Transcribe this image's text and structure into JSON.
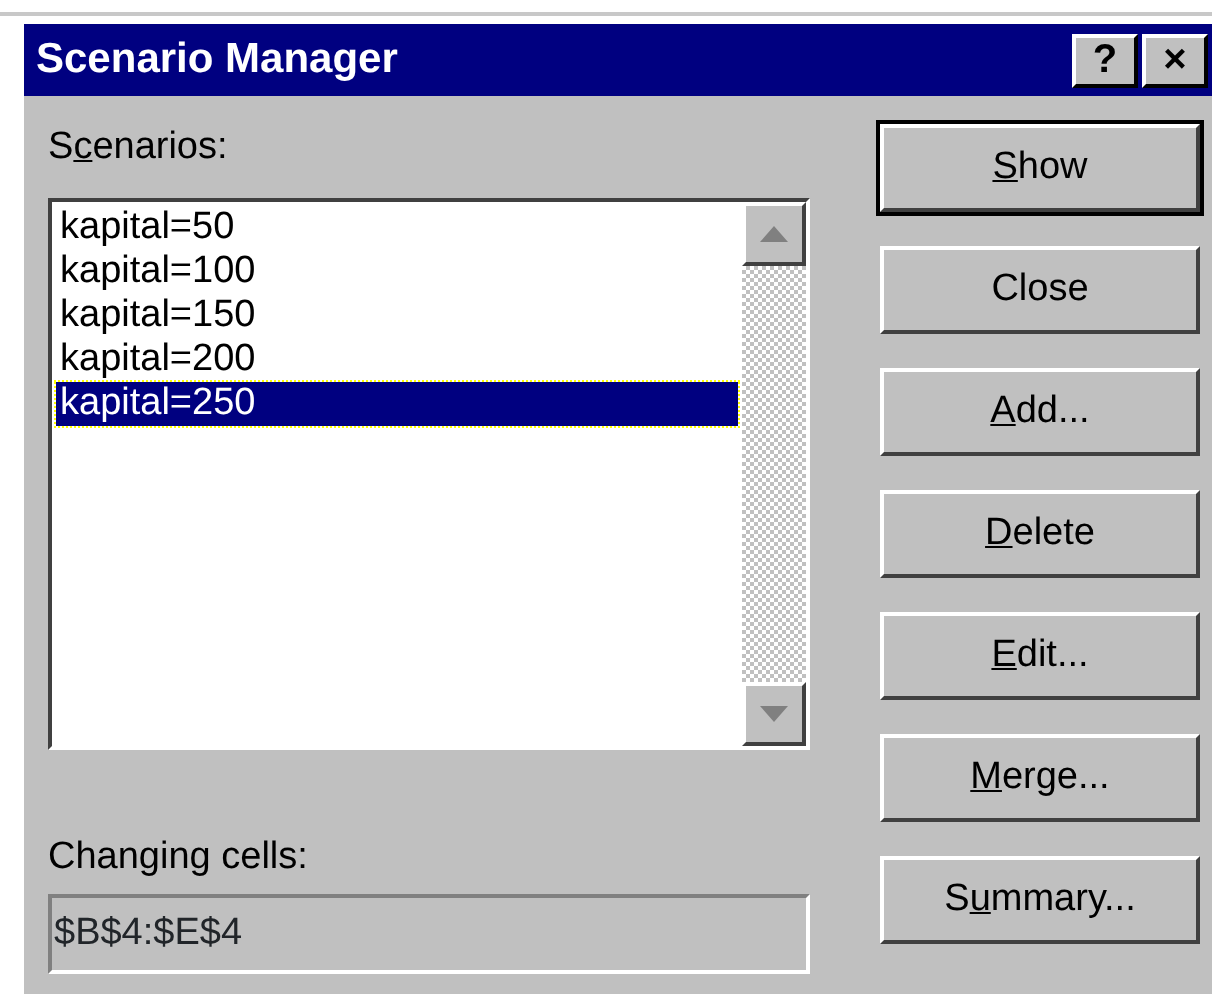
{
  "window": {
    "title": "Scenario Manager",
    "help_button": "?",
    "close_button": "×"
  },
  "scenarios": {
    "label": {
      "before": "S",
      "key": "c",
      "after": "enarios:"
    },
    "items": [
      {
        "label": "kapital=50",
        "selected": false
      },
      {
        "label": "kapital=100",
        "selected": false
      },
      {
        "label": "kapital=150",
        "selected": false
      },
      {
        "label": "kapital=200",
        "selected": false
      },
      {
        "label": "kapital=250",
        "selected": true
      }
    ]
  },
  "changing_cells": {
    "label": "Changing cells:",
    "value": "$B$4:$E$4"
  },
  "buttons": [
    {
      "key": "S",
      "after": "how",
      "default": true
    },
    {
      "after": "Close",
      "default": false
    },
    {
      "key": "A",
      "after": "dd...",
      "default": false
    },
    {
      "key": "D",
      "after": "elete",
      "default": false
    },
    {
      "key": "E",
      "after": "dit...",
      "default": false
    },
    {
      "key": "M",
      "after": "erge...",
      "default": false
    },
    {
      "before": "S",
      "key": "u",
      "after": "mmary...",
      "default": false
    }
  ]
}
